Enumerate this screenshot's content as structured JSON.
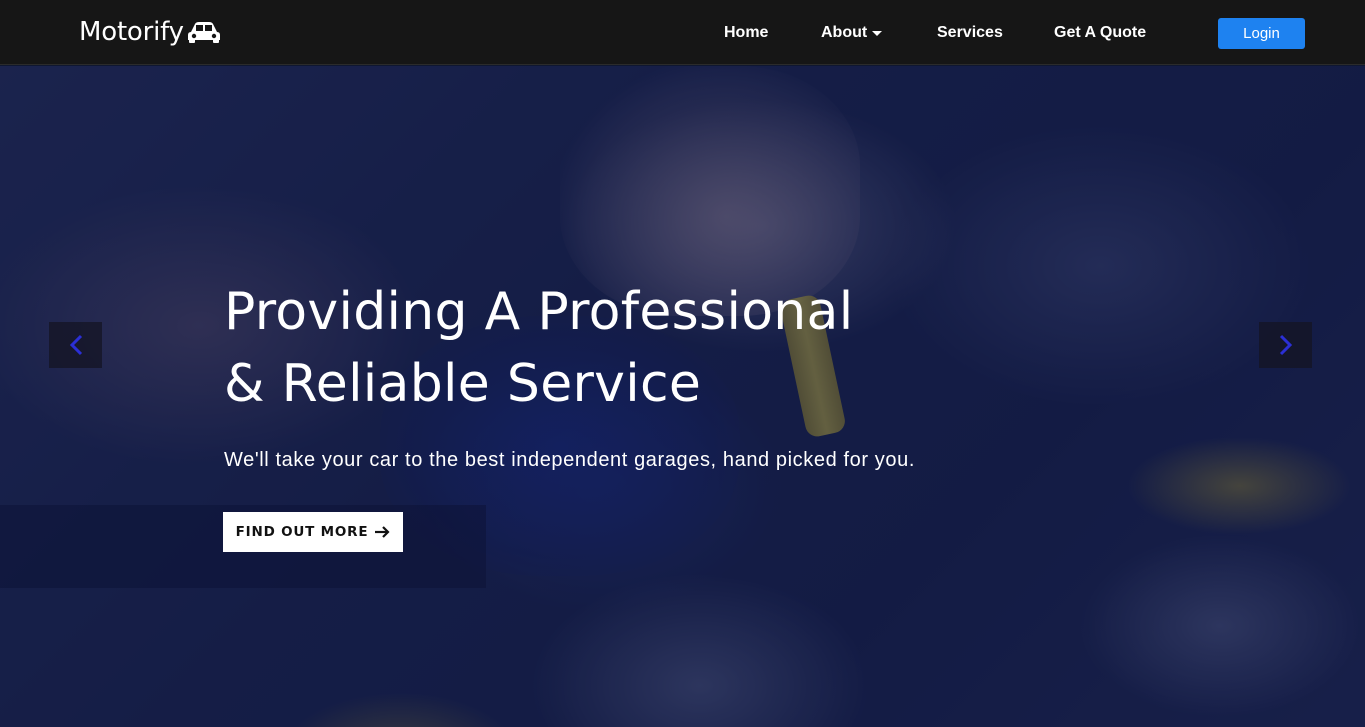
{
  "navbar": {
    "brand": "Motorify",
    "brand_icon": "car-icon",
    "links": [
      {
        "label": "Home"
      },
      {
        "label": "About",
        "has_dropdown": true
      },
      {
        "label": "Services"
      },
      {
        "label": "Get A Quote"
      }
    ],
    "login_label": "Login"
  },
  "hero": {
    "headline_line1": "Providing A Professional",
    "headline_line2": "& Reliable Service",
    "subtitle": "We'll take your car to the best independent garages, hand picked for you.",
    "cta_label": "FIND OUT MORE",
    "cta_icon": "arrow-right-icon",
    "prev_icon": "chevron-left-icon",
    "next_icon": "chevron-right-icon"
  },
  "colors": {
    "navbar_bg": "#161616",
    "accent": "#1e82f0",
    "overlay": "#0e1646",
    "carousel_arrow": "#2b2fd6"
  }
}
